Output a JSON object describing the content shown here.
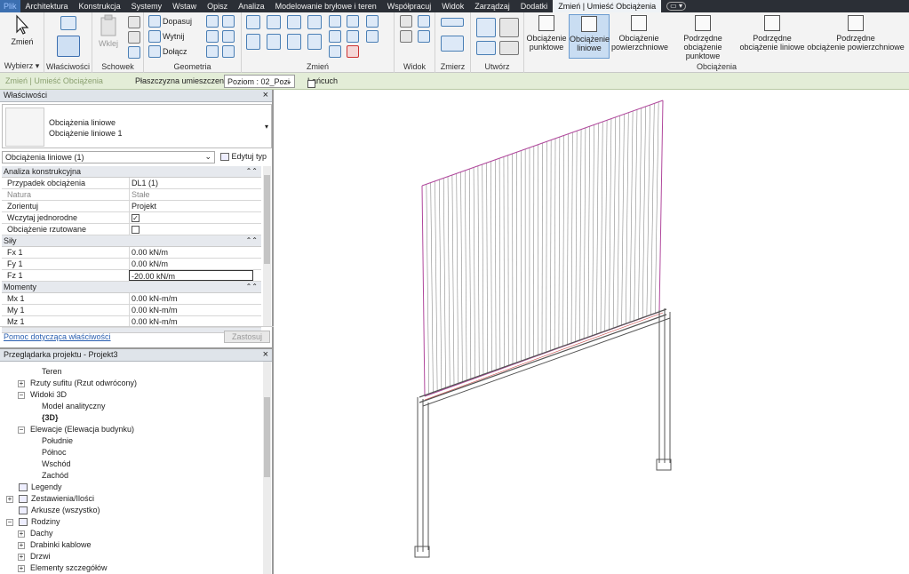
{
  "tabs": [
    "Plik",
    "Architektura",
    "Konstrukcja",
    "Systemy",
    "Wstaw",
    "Opisz",
    "Analiza",
    "Modelowanie bryłowe i teren",
    "Współpracuj",
    "Widok",
    "Zarządzaj",
    "Dodatki",
    "Zmień | Umieść Obciążenia"
  ],
  "ribbon": {
    "modify_label": "Zmień",
    "select_label": "Wybierz ▾",
    "properties_label": "Właściwości",
    "paste_label": "Wklej",
    "clipboard_label": "Schowek",
    "cope": "Dopasuj",
    "cut": "Wytnij",
    "join": "Dołącz",
    "geometry_label": "Geometria",
    "modify_panel_label": "Zmień",
    "view_label": "Widok",
    "measure_label": "Zmierz",
    "create_label": "Utwórz",
    "loads_label": "Obciążenia",
    "load_buttons": [
      {
        "l1": "Obciążenie",
        "l2": "punktowe"
      },
      {
        "l1": "Obciążenie",
        "l2": "liniowe"
      },
      {
        "l1": "Obciążenie",
        "l2": "powierzchniowe"
      },
      {
        "l1": "Podrzędne",
        "l2": "obciążenie punktowe"
      },
      {
        "l1": "Podrzędne",
        "l2": "obciążenie liniowe"
      },
      {
        "l1": "Podrzędne",
        "l2": "obciążenie powierzchniowe"
      }
    ]
  },
  "optionsbar": {
    "context": "Zmień | Umieść Obciążenia",
    "plane_label": "Płaszczyzna umieszczenia:",
    "plane_value": "Poziom : 02_Pozi",
    "chain_label": "Łańcuch"
  },
  "properties": {
    "header": "Właściwości",
    "type_line1": "Obciążenia liniowe",
    "type_line2": "Obciążenie liniowe 1",
    "selector": "Obciążenia liniowe (1)",
    "edit_type": "Edytuj typ",
    "groups": [
      {
        "name": "Analiza konstrukcyjna",
        "rows": [
          {
            "k": "Przypadek obciążenia",
            "v": "DL1 (1)"
          },
          {
            "k": "Natura",
            "v": "Stałe",
            "dim": true
          },
          {
            "k": "Zorientuj",
            "v": "Projekt"
          },
          {
            "k": "Wczytaj jednorodne",
            "v": "",
            "check": true
          },
          {
            "k": "Obciążenie rzutowane",
            "v": "",
            "check": false
          }
        ]
      },
      {
        "name": "Siły",
        "rows": [
          {
            "k": "Fx 1",
            "v": "0.00 kN/m"
          },
          {
            "k": "Fy 1",
            "v": "0.00 kN/m"
          },
          {
            "k": "Fz 1",
            "v": "-20.00 kN/m",
            "edit": true
          }
        ]
      },
      {
        "name": "Momenty",
        "rows": [
          {
            "k": "Mx 1",
            "v": "0.00 kN-m/m"
          },
          {
            "k": "My 1",
            "v": "0.00 kN-m/m"
          },
          {
            "k": "Mz 1",
            "v": "0.00 kN-m/m"
          }
        ]
      }
    ],
    "help_link": "Pomoc dotycząca właściwości",
    "apply": "Zastosuj"
  },
  "browser": {
    "header": "Przeglądarka projektu - Projekt3",
    "nodes": [
      {
        "label": "Teren",
        "indent": 3,
        "tog": "",
        "icon": false
      },
      {
        "label": "Rzuty sufitu (Rzut odwrócony)",
        "indent": 2,
        "tog": "+",
        "icon": false
      },
      {
        "label": "Widoki 3D",
        "indent": 2,
        "tog": "−",
        "icon": false
      },
      {
        "label": "Model analityczny",
        "indent": 3,
        "tog": "",
        "icon": false
      },
      {
        "label": "{3D}",
        "indent": 3,
        "tog": "",
        "icon": false,
        "bold": true
      },
      {
        "label": "Elewacje (Elewacja budynku)",
        "indent": 2,
        "tog": "−",
        "icon": false
      },
      {
        "label": "Południe",
        "indent": 3,
        "tog": "",
        "icon": false
      },
      {
        "label": "Północ",
        "indent": 3,
        "tog": "",
        "icon": false
      },
      {
        "label": "Wschód",
        "indent": 3,
        "tog": "",
        "icon": false
      },
      {
        "label": "Zachód",
        "indent": 3,
        "tog": "",
        "icon": false
      },
      {
        "label": "Legendy",
        "indent": 1,
        "tog": "",
        "icon": true
      },
      {
        "label": "Zestawienia/Ilości",
        "indent": 1,
        "tog": "+",
        "icon": true
      },
      {
        "label": "Arkusze (wszystko)",
        "indent": 1,
        "tog": "",
        "icon": true
      },
      {
        "label": "Rodziny",
        "indent": 1,
        "tog": "−",
        "icon": true
      },
      {
        "label": "Dachy",
        "indent": 2,
        "tog": "+",
        "icon": false
      },
      {
        "label": "Drabinki kablowe",
        "indent": 2,
        "tog": "+",
        "icon": false
      },
      {
        "label": "Drzwi",
        "indent": 2,
        "tog": "+",
        "icon": false
      },
      {
        "label": "Elementy szczegółów",
        "indent": 2,
        "tog": "+",
        "icon": false
      }
    ]
  },
  "colors": {
    "load": "#b0479c",
    "beam": "#555555",
    "accent": "#3c6fb0"
  }
}
